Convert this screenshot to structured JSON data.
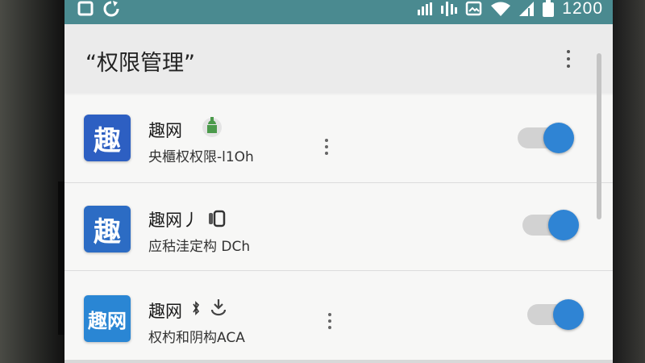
{
  "status_bar": {
    "left_icons": [
      "square-notification-icon",
      "sync-icon"
    ],
    "right_icons": [
      "signal-icon",
      "signal-icon",
      "image-notification-icon",
      "wifi-icon",
      "cell-signal-icon",
      "battery-icon"
    ],
    "time": "1200",
    "color": "#4a8a90"
  },
  "header": {
    "title": "“权限管理”",
    "overflow_icon": "more-vertical-icon"
  },
  "apps": [
    {
      "icon_text": "趣",
      "icon_color": "#2d5fc2",
      "name": "趣网",
      "badge_icon": "android-robot-icon",
      "subtitle": "央櫃权权限-l1Oh",
      "has_menu": true,
      "toggle_on": true
    },
    {
      "icon_text": "趣",
      "icon_color": "#2c6cc4",
      "name": "趣网丿",
      "badge_icon": "phone-icon",
      "subtitle": "应秙洼定构 DCh",
      "has_menu": false,
      "toggle_on": true
    },
    {
      "icon_text": "趣网",
      "icon_color": "#2a86d4",
      "name": "趣网",
      "name_suffix": "",
      "badge_icon": "download-icon",
      "subtitle": "权杓和阴构ACA",
      "has_menu": true,
      "toggle_on": true
    }
  ],
  "toggle_color": "#2f84d4"
}
